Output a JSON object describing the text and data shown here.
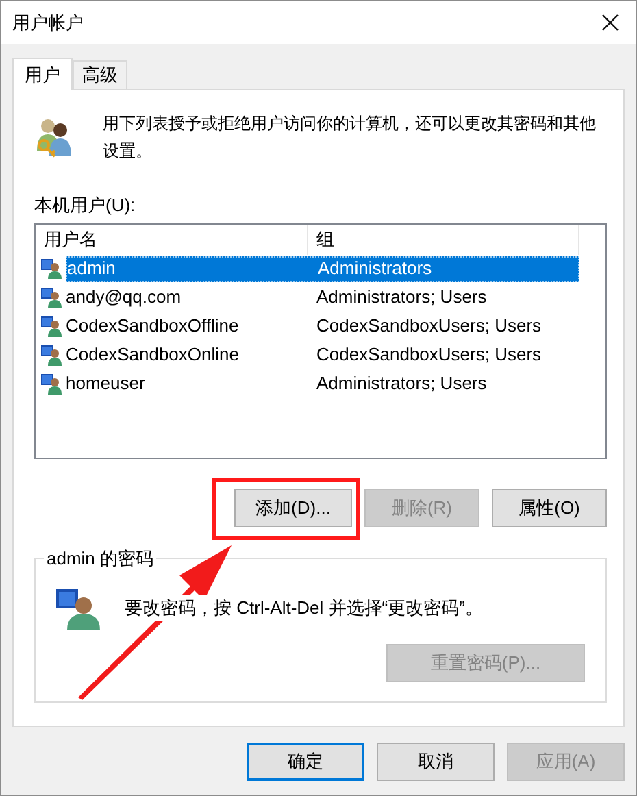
{
  "window": {
    "title": "用户帐户"
  },
  "tabs": [
    {
      "label": "用户",
      "selected": true
    },
    {
      "label": "高级",
      "selected": false
    }
  ],
  "intro": "用下列表授予或拒绝用户访问你的计算机，还可以更改其密码和其他设置。",
  "list_label": "本机用户(U):",
  "table": {
    "columns": [
      "用户名",
      "组"
    ],
    "rows": [
      {
        "name": "admin",
        "group": "Administrators",
        "selected": true
      },
      {
        "name": "andy@qq.com",
        "group": "Administrators; Users",
        "selected": false
      },
      {
        "name": "CodexSandboxOffline",
        "group": "CodexSandboxUsers; Users",
        "selected": false
      },
      {
        "name": "CodexSandboxOnline",
        "group": "CodexSandboxUsers; Users",
        "selected": false
      },
      {
        "name": "homeuser",
        "group": "Administrators; Users",
        "selected": false
      }
    ]
  },
  "list_buttons": [
    {
      "label": "添加(D)...",
      "disabled": false
    },
    {
      "label": "删除(R)",
      "disabled": true
    },
    {
      "label": "属性(O)",
      "disabled": false
    }
  ],
  "password_group": {
    "title": "admin 的密码",
    "text": "要改密码，按 Ctrl-Alt-Del 并选择“更改密码”。",
    "button": {
      "label": "重置密码(P)...",
      "disabled": true
    }
  },
  "footer_buttons": [
    {
      "label": "确定",
      "disabled": false,
      "default": true
    },
    {
      "label": "取消",
      "disabled": false,
      "default": false
    },
    {
      "label": "应用(A)",
      "disabled": true,
      "default": false
    }
  ]
}
